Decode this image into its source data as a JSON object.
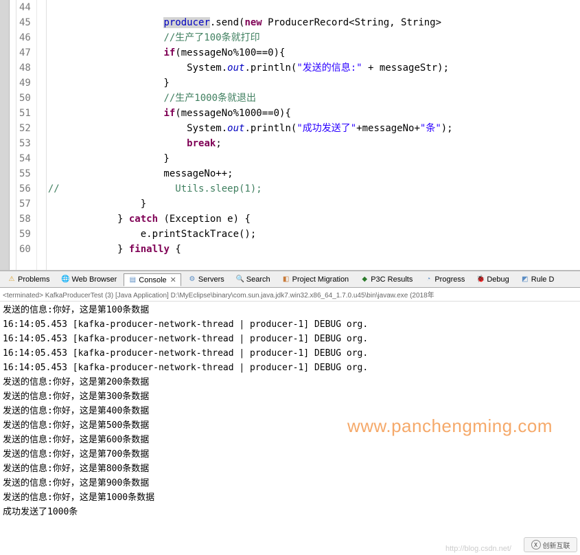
{
  "editor": {
    "lines": [
      {
        "n": 44,
        "frag": [
          {
            "t": "                    ",
            "c": ""
          }
        ]
      },
      {
        "n": 45,
        "frag": [
          {
            "t": "                    ",
            "c": ""
          },
          {
            "t": "producer",
            "c": "fld hl"
          },
          {
            "t": ".send(",
            "c": ""
          },
          {
            "t": "new",
            "c": "kw"
          },
          {
            "t": " ProducerRecord<String, String>",
            "c": ""
          }
        ]
      },
      {
        "n": 46,
        "frag": [
          {
            "t": "                    ",
            "c": ""
          },
          {
            "t": "//生产了100条就打印",
            "c": "cmt"
          }
        ]
      },
      {
        "n": 47,
        "frag": [
          {
            "t": "                    ",
            "c": ""
          },
          {
            "t": "if",
            "c": "kw"
          },
          {
            "t": "(messageNo%100==0){",
            "c": ""
          }
        ]
      },
      {
        "n": 48,
        "frag": [
          {
            "t": "                        System.",
            "c": ""
          },
          {
            "t": "out",
            "c": "sifld"
          },
          {
            "t": ".println(",
            "c": ""
          },
          {
            "t": "\"发送的信息:\"",
            "c": "str"
          },
          {
            "t": " + messageStr);",
            "c": ""
          }
        ]
      },
      {
        "n": 49,
        "frag": [
          {
            "t": "                    }",
            "c": ""
          }
        ]
      },
      {
        "n": 50,
        "frag": [
          {
            "t": "                    ",
            "c": ""
          },
          {
            "t": "//生产1000条就退出",
            "c": "cmt"
          }
        ]
      },
      {
        "n": 51,
        "frag": [
          {
            "t": "                    ",
            "c": ""
          },
          {
            "t": "if",
            "c": "kw"
          },
          {
            "t": "(messageNo%1000==0){",
            "c": ""
          }
        ]
      },
      {
        "n": 52,
        "frag": [
          {
            "t": "                        System.",
            "c": ""
          },
          {
            "t": "out",
            "c": "sifld"
          },
          {
            "t": ".println(",
            "c": ""
          },
          {
            "t": "\"成功发送了\"",
            "c": "str"
          },
          {
            "t": "+messageNo+",
            "c": ""
          },
          {
            "t": "\"条\"",
            "c": "str"
          },
          {
            "t": ");",
            "c": ""
          }
        ]
      },
      {
        "n": 53,
        "frag": [
          {
            "t": "                        ",
            "c": ""
          },
          {
            "t": "break",
            "c": "kw"
          },
          {
            "t": ";",
            "c": ""
          }
        ]
      },
      {
        "n": 54,
        "frag": [
          {
            "t": "                    }",
            "c": ""
          }
        ]
      },
      {
        "n": 55,
        "frag": [
          {
            "t": "                    messageNo++;",
            "c": ""
          }
        ]
      },
      {
        "n": 56,
        "frag": [
          {
            "t": "//                    Utils.sleep(1);",
            "c": "cmt"
          }
        ]
      },
      {
        "n": 57,
        "frag": [
          {
            "t": "                }",
            "c": ""
          }
        ]
      },
      {
        "n": 58,
        "frag": [
          {
            "t": "            } ",
            "c": ""
          },
          {
            "t": "catch",
            "c": "kw"
          },
          {
            "t": " (Exception e) {",
            "c": ""
          }
        ]
      },
      {
        "n": 59,
        "frag": [
          {
            "t": "                e.printStackTrace();",
            "c": ""
          }
        ]
      },
      {
        "n": 60,
        "frag": [
          {
            "t": "            } ",
            "c": ""
          },
          {
            "t": "finally",
            "c": "kw"
          },
          {
            "t": " {",
            "c": ""
          }
        ]
      }
    ]
  },
  "tabs": [
    {
      "icon": "⚠",
      "color": "#d9a334",
      "label": "Problems"
    },
    {
      "icon": "🌐",
      "color": "#3b78b5",
      "label": "Web Browser"
    },
    {
      "icon": "▤",
      "color": "#5b8dc4",
      "label": "Console",
      "active": true
    },
    {
      "icon": "⚙",
      "color": "#5b8dc4",
      "label": "Servers"
    },
    {
      "icon": "🔍",
      "color": "#5b8dc4",
      "label": "Search"
    },
    {
      "icon": "◧",
      "color": "#c97b3a",
      "label": "Project Migration"
    },
    {
      "icon": "◆",
      "color": "#2a7a2a",
      "label": "P3C Results"
    },
    {
      "icon": "◔",
      "color": "#5b8dc4",
      "label": "Progress"
    },
    {
      "icon": "🐞",
      "color": "#2a7a2a",
      "label": "Debug"
    },
    {
      "icon": "◩",
      "color": "#5b8dc4",
      "label": "Rule D"
    }
  ],
  "terminated": "<terminated> KafkaProducerTest (3) [Java Application] D:\\MyEclipse\\binary\\com.sun.java.jdk7.win32.x86_64_1.7.0.u45\\bin\\javaw.exe (2018年",
  "console_lines": [
    "发送的信息:你好，这是第100条数据",
    "16:14:05.453 [kafka-producer-network-thread | producer-1] DEBUG org.",
    "16:14:05.453 [kafka-producer-network-thread | producer-1] DEBUG org.",
    "16:14:05.453 [kafka-producer-network-thread | producer-1] DEBUG org.",
    "16:14:05.453 [kafka-producer-network-thread | producer-1] DEBUG org.",
    "发送的信息:你好，这是第200条数据",
    "发送的信息:你好，这是第300条数据",
    "发送的信息:你好，这是第400条数据",
    "发送的信息:你好，这是第500条数据",
    "发送的信息:你好，这是第600条数据",
    "发送的信息:你好，这是第700条数据",
    "发送的信息:你好，这是第800条数据",
    "发送的信息:你好，这是第900条数据",
    "发送的信息:你好，这是第1000条数据",
    "成功发送了1000条"
  ],
  "watermark": "www.panchengming.com",
  "footer_watermark": "http://blog.csdn.net/",
  "logo_text": "创新互联"
}
